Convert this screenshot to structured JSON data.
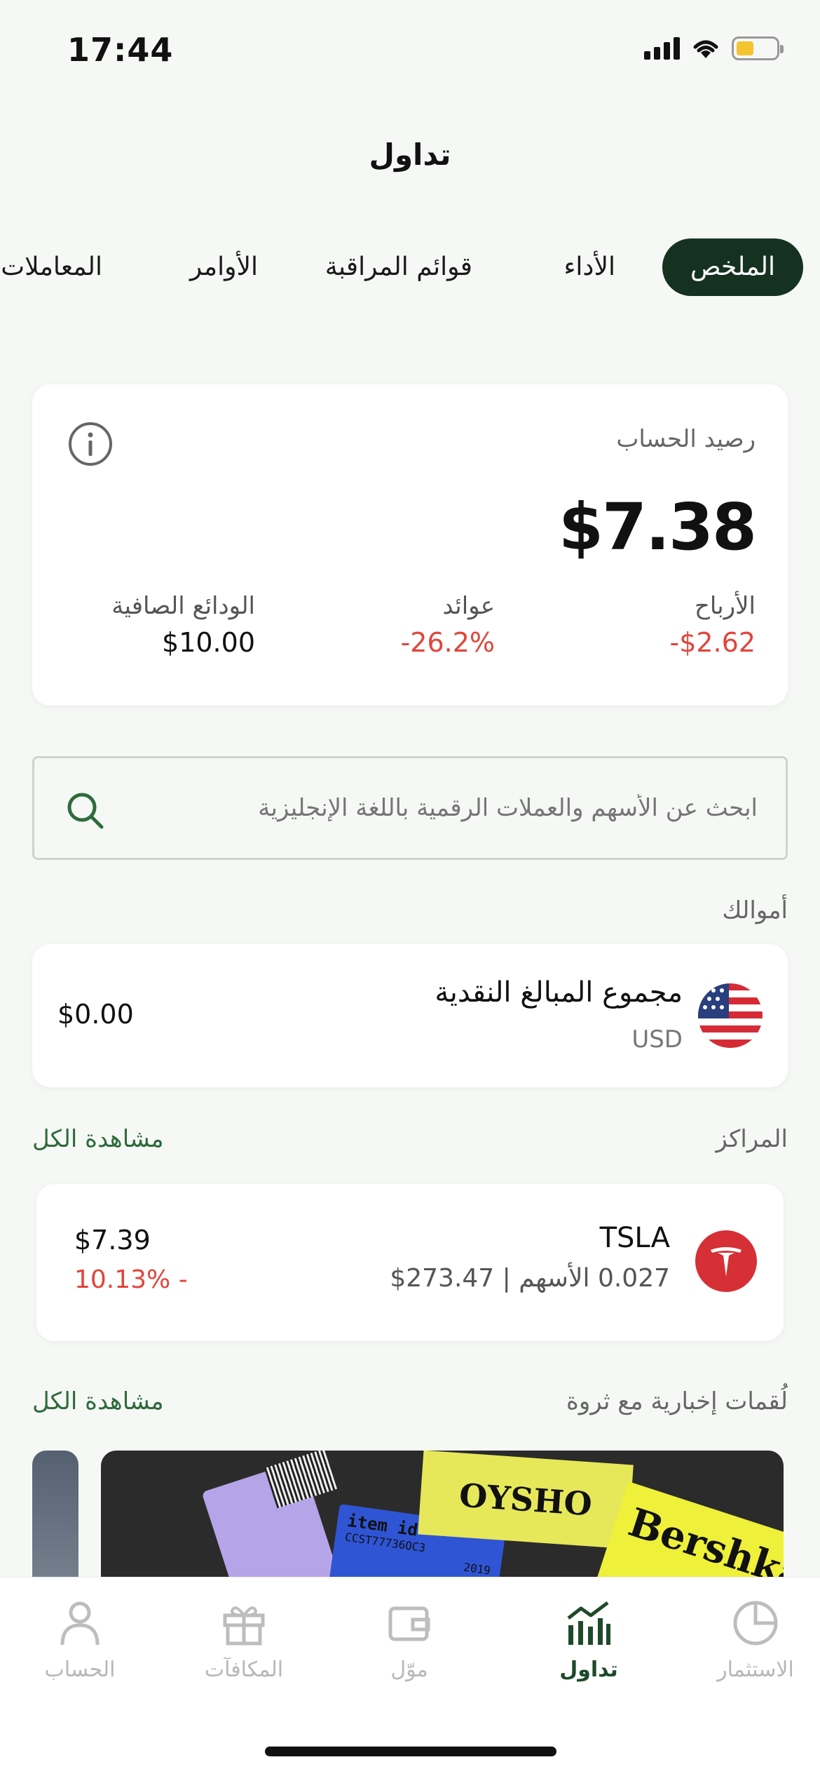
{
  "status_bar": {
    "time": "17:44"
  },
  "header": {
    "title": "تداول"
  },
  "tabs": [
    {
      "label": "الملخص",
      "active": true
    },
    {
      "label": "الأداء"
    },
    {
      "label": "قوائم المراقبة"
    },
    {
      "label": "الأوامر"
    },
    {
      "label": "المعاملات"
    }
  ],
  "balance": {
    "label": "رصيد الحساب",
    "value": "$7.38",
    "profits_label": "الأرباح",
    "profits_value": "-$2.62",
    "returns_label": "عوائد",
    "returns_value": "-26.2%",
    "deposits_label": "الودائع الصافية",
    "deposits_value": "$10.00"
  },
  "search": {
    "placeholder": "ابحث عن الأسهم والعملات الرقمية باللغة الإنجليزية"
  },
  "funds": {
    "section_label": "أموالك",
    "title": "مجموع المبالغ النقدية",
    "currency": "USD",
    "value": "$0.00"
  },
  "positions": {
    "section_label": "المراكز",
    "see_all": "مشاهدة الكل",
    "items": [
      {
        "symbol": "TSLA",
        "shares": "0.027 الأسهم | 273.47$",
        "value": "$7.39",
        "change": "10.13% -"
      }
    ]
  },
  "news": {
    "section_label": "لُقمات إخبارية مع ثروة",
    "see_all": "مشاهدة الكل",
    "tags": [
      "OYSHO",
      "item id",
      "CCST77736OC3",
      "2019",
      "Bershka"
    ]
  },
  "bottom_nav": [
    {
      "label": "الاستثمار",
      "icon": "pie-chart-icon"
    },
    {
      "label": "تداول",
      "icon": "bar-chart-icon",
      "active": true
    },
    {
      "label": "موّل",
      "icon": "wallet-icon"
    },
    {
      "label": "المكافآت",
      "icon": "gift-icon"
    },
    {
      "label": "الحساب",
      "icon": "person-icon"
    }
  ],
  "colors": {
    "accent": "#153221",
    "negative": "#e0453a",
    "link": "#2e6b3b"
  }
}
